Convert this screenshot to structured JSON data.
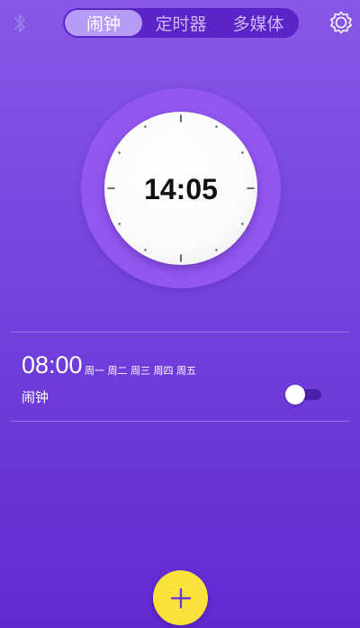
{
  "header": {
    "tabs": [
      {
        "label": "闹钟",
        "active": true
      },
      {
        "label": "定时器",
        "active": false
      },
      {
        "label": "多媒体",
        "active": false
      }
    ],
    "left_icon": "bluetooth-icon",
    "right_icon": "settings-icon"
  },
  "clock": {
    "time": "14:05"
  },
  "alarms": [
    {
      "time": "08:00",
      "days": "周一 周二 周三 周四 周五",
      "label": "闹钟",
      "enabled": false
    }
  ],
  "fab": {
    "icon": "plus-icon"
  },
  "colors": {
    "background_top": "#8758e6",
    "background_bottom": "#6228d2",
    "tab_active": "#b79bf6",
    "tab_bar": "#5a24c8",
    "clock_ring": "#9357f0",
    "fab": "#fbe23a",
    "toggle_track": "#4a1fab"
  }
}
